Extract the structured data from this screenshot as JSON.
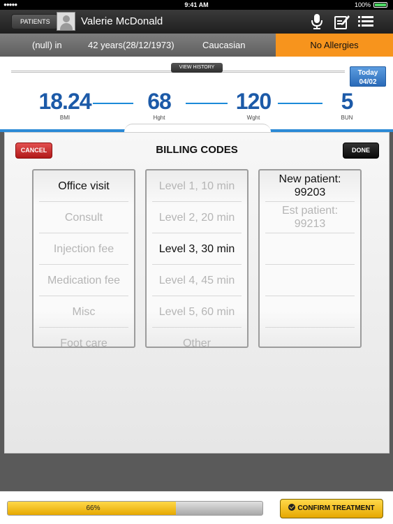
{
  "status_bar": {
    "signal": "●●●●● ",
    "time": "9:41 AM",
    "battery": "100%"
  },
  "header": {
    "back_label": "PATIENTS",
    "patient_name": "Valerie McDonald",
    "icons": [
      "microphone-icon",
      "edit-note-icon",
      "list-icon"
    ]
  },
  "info_bar": {
    "weight": "(null) in",
    "age": "42 years(28/12/1973)",
    "ethnicity": "Caucasian",
    "allergies": "No Allergies",
    "allergy_color": "#f7941d"
  },
  "vitals": {
    "view_history_label": "VIEW HISTORY",
    "today_label": "Today",
    "today_date": "04/02",
    "items": [
      {
        "value": "18.24",
        "label": "BMI"
      },
      {
        "value": "68",
        "label": "Hght"
      },
      {
        "value": "120",
        "label": "Wght"
      },
      {
        "value": "5",
        "label": "BUN"
      }
    ],
    "value_color": "#1c5aa8"
  },
  "billing": {
    "title": "BILLING CODES",
    "cancel_label": "CANCEL",
    "done_label": "DONE",
    "visit_types": [
      "Office visit",
      "Consult",
      "Injection fee",
      "Medication fee",
      "Misc",
      "Foot care"
    ],
    "visit_selected": 0,
    "levels": [
      "Level 1, 10 min",
      "Level 2, 20 min",
      "Level 3, 30 min",
      "Level 4, 45 min",
      "Level 5, 60 min",
      "Other"
    ],
    "level_selected": 2,
    "codes": [
      "New patient: 99203",
      "Est patient: 99213"
    ],
    "code_selected": 0
  },
  "footer": {
    "progress_label": "66%",
    "progress_value": 0.66,
    "confirm_label": "CONFIRM TREATMENT"
  }
}
